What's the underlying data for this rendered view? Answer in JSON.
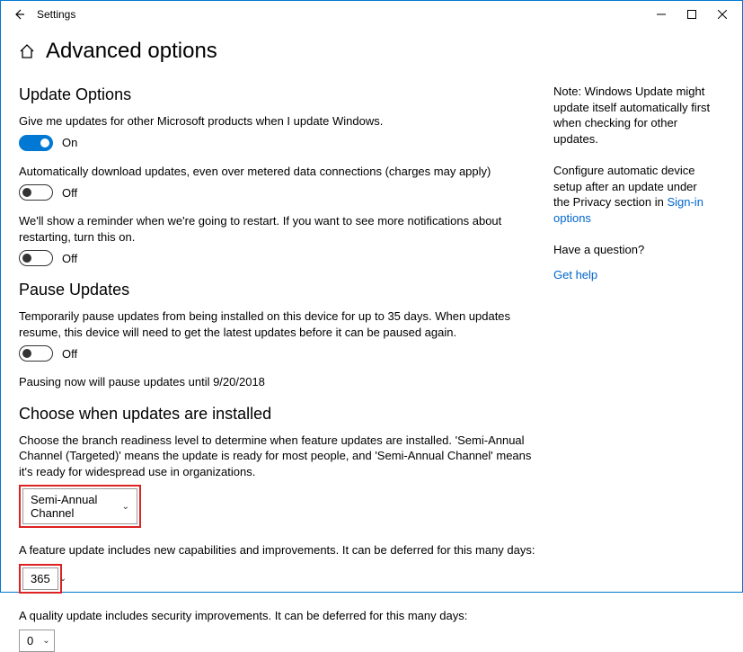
{
  "titlebar": {
    "title": "Settings"
  },
  "page": {
    "title": "Advanced options"
  },
  "sections": {
    "update_options": {
      "heading": "Update Options",
      "opt1_desc": "Give me updates for other Microsoft products when I update Windows.",
      "opt1_state": "On",
      "opt2_desc": "Automatically download updates, even over metered data connections (charges may apply)",
      "opt2_state": "Off",
      "opt3_desc": "We'll show a reminder when we're going to restart. If you want to see more notifications about restarting, turn this on.",
      "opt3_state": "Off"
    },
    "pause": {
      "heading": "Pause Updates",
      "desc": "Temporarily pause updates from being installed on this device for up to 35 days. When updates resume, this device will need to get the latest updates before it can be paused again.",
      "state": "Off",
      "note": "Pausing now will pause updates until 9/20/2018"
    },
    "choose": {
      "heading": "Choose when updates are installed",
      "desc": "Choose the branch readiness level to determine when feature updates are installed. 'Semi-Annual Channel (Targeted)' means the update is ready for most people, and 'Semi-Annual Channel' means it's ready for widespread use in organizations.",
      "branch_value": "Semi-Annual Channel",
      "feature_desc": "A feature update includes new capabilities and improvements. It can be deferred for this many days:",
      "feature_value": "365",
      "quality_desc": "A quality update includes security improvements. It can be deferred for this many days:",
      "quality_value": "0"
    }
  },
  "sidebar": {
    "note1": "Note: Windows Update might update itself automatically first when checking for other updates.",
    "note2_prefix": "Configure automatic device setup after an update under the Privacy section in ",
    "note2_link": "Sign-in options",
    "question": "Have a question?",
    "help_link": "Get help"
  }
}
